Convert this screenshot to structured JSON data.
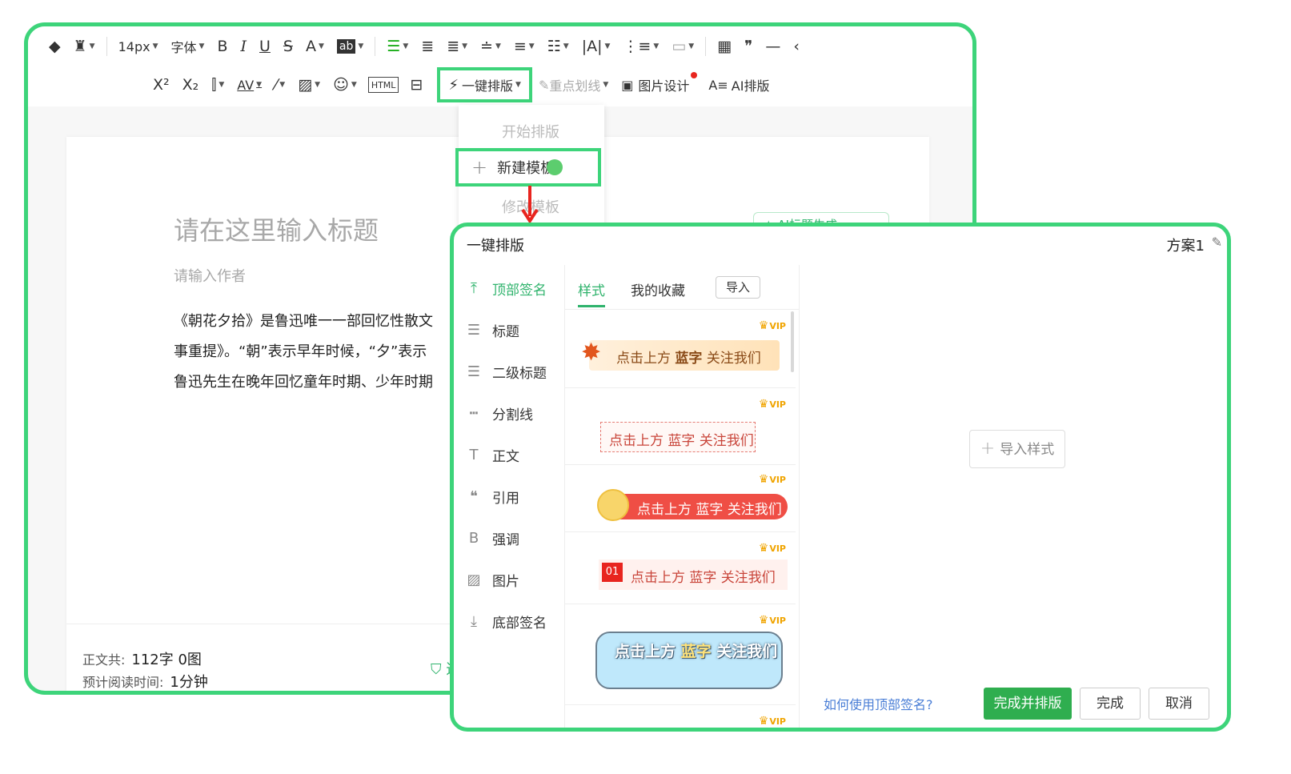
{
  "toolbar": {
    "row1": {
      "font_size": "14px",
      "font_family": "字体",
      "bold": "B",
      "italic": "I",
      "underline": "U",
      "strike": "S",
      "font_color": "A",
      "bg_color": "ab"
    },
    "row2": {
      "superscript": "X²",
      "subscript": "X₂",
      "letter_spacing": "AV",
      "html": "HTML",
      "one_click_layout": "一键排版",
      "highlight_line": "重点划线",
      "image_design": "图片设计",
      "ai_layout": "AI排版"
    }
  },
  "editor": {
    "title_placeholder": "请在这里输入标题",
    "author_placeholder": "请输入作者",
    "body_lines": [
      "《朝花夕拾》是鲁迅唯一一部回忆性散文",
      "事重提》。“朝”表示早年时候，“夕”表示",
      "鲁迅先生在晚年回忆童年时期、少年时期"
    ],
    "ai_title_button": "AI标题生成",
    "status": {
      "word_count_label": "正文共:",
      "word_count_value": "112字 0图",
      "read_time_label": "预计阅读时间:",
      "read_time_value": "1分钟",
      "violation_check": "违规"
    }
  },
  "dropdown": {
    "items": [
      "开始排版",
      "新建模板",
      "修改模板"
    ]
  },
  "dialog": {
    "title": "一键排版",
    "scheme_name": "方案1",
    "nav": [
      {
        "label": "顶部签名",
        "icon": "arrow-up-to-line-icon",
        "active": true
      },
      {
        "label": "标题",
        "icon": "lines-icon",
        "active": false
      },
      {
        "label": "二级标题",
        "icon": "lines-icon",
        "active": false
      },
      {
        "label": "分割线",
        "icon": "divider-icon",
        "active": false
      },
      {
        "label": "正文",
        "icon": "text-t-icon",
        "active": false
      },
      {
        "label": "引用",
        "icon": "quote-icon",
        "active": false
      },
      {
        "label": "强调",
        "icon": "bold-b-icon",
        "active": false
      },
      {
        "label": "图片",
        "icon": "image-icon",
        "active": false
      },
      {
        "label": "底部签名",
        "icon": "arrow-down-to-line-icon",
        "active": false
      }
    ],
    "tabs": {
      "style": "样式",
      "favorites": "我的收藏",
      "import": "导入"
    },
    "vip_label": "VIP",
    "samples": {
      "s1": {
        "pre": "点击上方 ",
        "blue": "蓝字",
        "post": " 关注我们"
      },
      "s2": {
        "pre": "点击上方 ",
        "blue": "蓝字",
        "post": " 关注我们"
      },
      "s3": {
        "pre": "点击上方 ",
        "blue": "蓝字",
        "post": " 关注我们"
      },
      "s4": {
        "num": "01",
        "pre": "点击上方 ",
        "blue": "蓝字",
        "post": " 关注我们"
      },
      "s5": {
        "pre": "点击上方 ",
        "blue": "蓝字",
        "post": " 关注我们"
      }
    },
    "import_style": "导入样式",
    "help_link": "如何使用顶部签名?",
    "btn_finish_apply": "完成并排版",
    "btn_finish": "完成",
    "btn_cancel": "取消"
  },
  "colors": {
    "highlight_border": "#3dd47a",
    "accent_green": "#2fb36c",
    "arrow_red": "#e8251f"
  }
}
